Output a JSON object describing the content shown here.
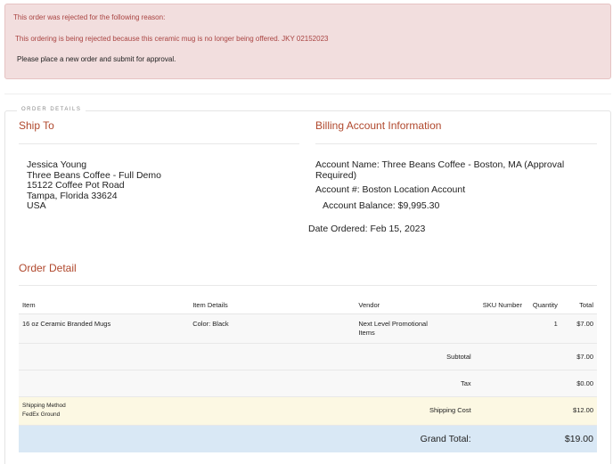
{
  "alert": {
    "heading": "This order was rejected for the following reason:",
    "reason": "This ordering is being rejected because this ceramic mug is no longer being offered. JKY 02152023",
    "instruction": "Please place a new order and submit for approval."
  },
  "legend": "ORDER DETAILS",
  "ship_to": {
    "title": "Ship To",
    "name": "Jessica Young",
    "company": "Three Beans Coffee - Full Demo",
    "street": "15122 Coffee Pot Road",
    "city_state_zip": "Tampa, Florida 33624",
    "country": "USA"
  },
  "billing": {
    "title": "Billing Account Information",
    "account_name_line1": "Account Name: Three Beans Coffee - Boston, MA (Approval",
    "account_name_line2": "Required)",
    "account_number": "Account #: Boston Location Account",
    "account_balance": "Account Balance: $9,995.30",
    "date_ordered": "Date Ordered: Feb 15, 2023"
  },
  "order_detail": {
    "title": "Order Detail",
    "headers": {
      "item": "Item",
      "details": "Item Details",
      "vendor": "Vendor",
      "sku": "SKU Number",
      "quantity": "Quantity",
      "total": "Total"
    },
    "rows": [
      {
        "item": "16 oz Ceramic Branded Mugs",
        "details": "Color: Black",
        "vendor_line1": "Next Level Promotional",
        "vendor_line2": "Items",
        "sku": "",
        "quantity": "1",
        "total": "$7.00"
      }
    ],
    "subtotal_label": "Subtotal",
    "subtotal": "$7.00",
    "tax_label": "Tax",
    "tax": "$0.00",
    "shipping_method_label": "Shipping Method",
    "shipping_method": "FedEx Ground",
    "shipping_cost_label": "Shipping Cost",
    "shipping_cost": "$12.00",
    "grand_total_label": "Grand Total:",
    "grand_total": "$19.00"
  },
  "colors": {
    "alert_bg": "#f2dede",
    "alert_text": "#a94442",
    "accent": "#b0482d",
    "shipping_row_bg": "#fcf8e3",
    "grand_row_bg": "#d9e8f5"
  }
}
